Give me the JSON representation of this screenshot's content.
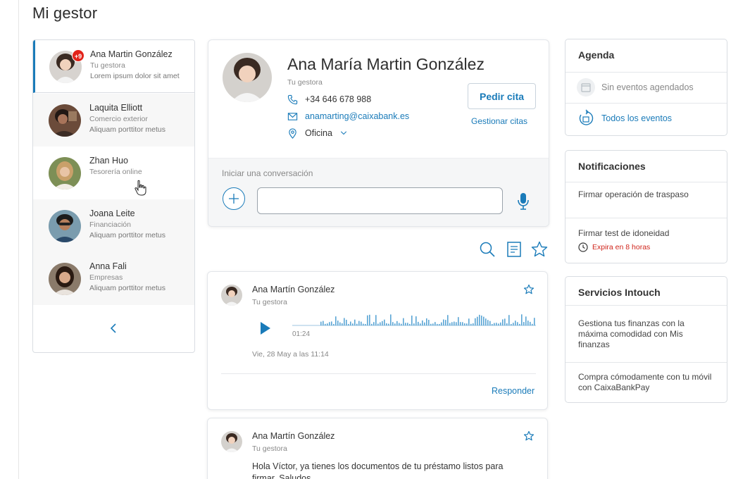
{
  "page": {
    "title": "Mi gestor"
  },
  "contacts": [
    {
      "name": "Ana Martin González",
      "role": "Tu gestora",
      "snippet": "Lorem ipsum dolor sit amet",
      "badge": "+9",
      "active": true
    },
    {
      "name": "Laquita Elliott",
      "role": "Comercio exterior",
      "snippet": "Aliquam porttitor metus"
    },
    {
      "name": "Zhan Huo",
      "role": "Tesorería online",
      "snippet": ""
    },
    {
      "name": "Joana Leite",
      "role": "Financiación",
      "snippet": "Aliquam porttitor metus"
    },
    {
      "name": "Anna Fali",
      "role": "Empresas",
      "snippet": "Aliquam porttitor metus"
    }
  ],
  "profile": {
    "name": "Ana María Martin González",
    "role": "Tu gestora",
    "phone": "+34 646 678 988",
    "email": "anamarting@caixabank.es",
    "office": "Oficina",
    "cta_label": "Pedir cita",
    "manage_link": "Gestionar citas"
  },
  "conversation": {
    "label": "Iniciar una conversación",
    "input_value": "",
    "placeholder": ""
  },
  "toolbar": {
    "icons": [
      "search-icon",
      "document-icon",
      "star-icon"
    ]
  },
  "messages": [
    {
      "sender": "Ana Martín González",
      "role": "Tu gestora",
      "type": "audio",
      "audio_time": "01:24",
      "date": "Vie, 28 May a las 11:14",
      "reply_label": "Responder"
    },
    {
      "sender": "Ana Martín González",
      "role": "Tu gestora",
      "type": "text",
      "text": "Hola Víctor, ya tienes los documentos de tu préstamo listos para firmar. Saludos"
    }
  ],
  "agenda": {
    "title": "Agenda",
    "empty_text": "Sin eventos agendados",
    "all_events_link": "Todos los eventos"
  },
  "notifications": {
    "title": "Notificaciones",
    "items": [
      {
        "text": "Firmar operación de traspaso"
      },
      {
        "text": "Firmar test de idoneidad",
        "expiry": "Expira en 8 horas"
      }
    ]
  },
  "services": {
    "title": "Servicios Intouch",
    "items": [
      {
        "text": "Gestiona tus finanzas con la máxima comodidad con Mis finanzas"
      },
      {
        "text": "Compra cómodamente con tu móvil con CaixaBankPay"
      }
    ]
  },
  "colors": {
    "accent": "#1a7bb9",
    "badge": "#e2231a",
    "alert": "#d0251c"
  }
}
